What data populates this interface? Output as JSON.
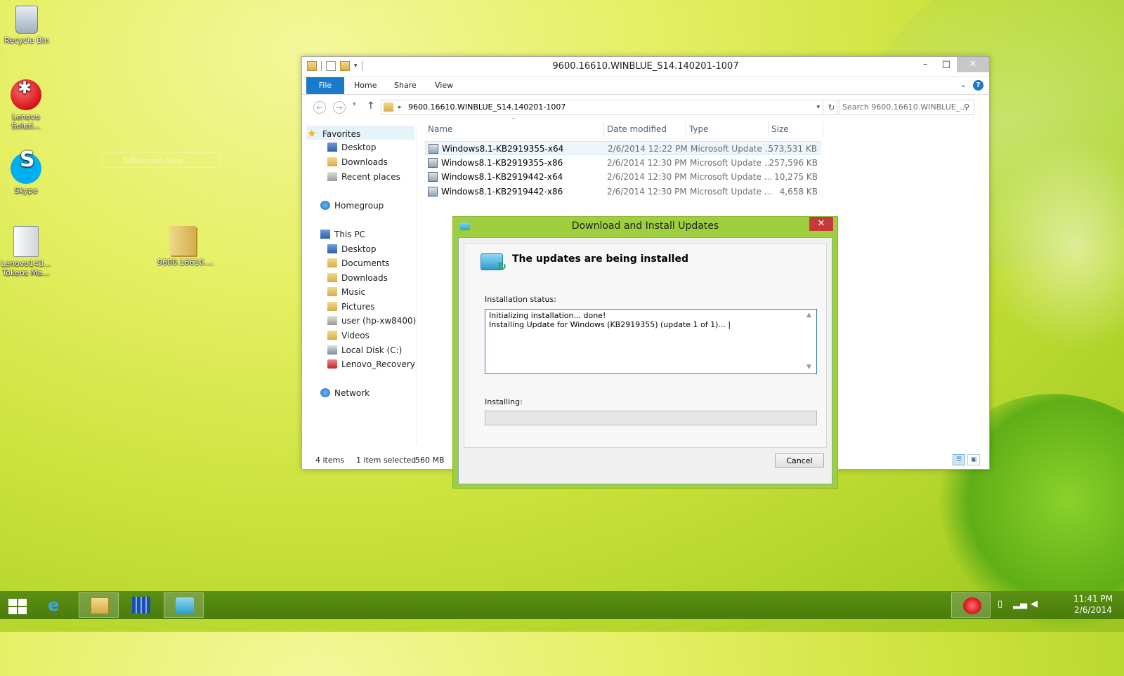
{
  "desktop": {
    "icons": [
      {
        "label": "Recycle Bin"
      },
      {
        "label": "Lenovo Soluti..."
      },
      {
        "label": "Skype"
      },
      {
        "label": "Lenovo143... Tokens Ma..."
      },
      {
        "label": "9600.16610...."
      }
    ],
    "snip_label": "Full-screen Snip"
  },
  "explorer": {
    "title": "9600.16610.WINBLUE_S14.140201-1007",
    "tabs": [
      "File",
      "Home",
      "Share",
      "View"
    ],
    "address": "9600.16610.WINBLUE_S14.140201-1007",
    "search_placeholder": "Search 9600.16610.WINBLUE_...",
    "nav": {
      "favorites": "Favorites",
      "fav_items": [
        "Desktop",
        "Downloads",
        "Recent places"
      ],
      "homegroup": "Homegroup",
      "thispc": "This PC",
      "pc_items": [
        "Desktop",
        "Documents",
        "Downloads",
        "Music",
        "Pictures",
        "user (hp-xw8400)",
        "Videos",
        "Local Disk (C:)",
        "Lenovo_Recovery (D"
      ],
      "network": "Network"
    },
    "columns": [
      "Name",
      "Date modified",
      "Type",
      "Size"
    ],
    "files": [
      {
        "name": "Windows8.1-KB2919355-x64",
        "date": "2/6/2014 12:22 PM",
        "type": "Microsoft Update ...",
        "size": "573,531 KB"
      },
      {
        "name": "Windows8.1-KB2919355-x86",
        "date": "2/6/2014 12:30 PM",
        "type": "Microsoft Update ...",
        "size": "257,596 KB"
      },
      {
        "name": "Windows8.1-KB2919442-x64",
        "date": "2/6/2014 12:30 PM",
        "type": "Microsoft Update ...",
        "size": "10,275 KB"
      },
      {
        "name": "Windows8.1-KB2919442-x86",
        "date": "2/6/2014 12:30 PM",
        "type": "Microsoft Update ...",
        "size": "4,658 KB"
      }
    ],
    "status": {
      "items": "4 items",
      "selected": "1 item selected",
      "size": "560 MB"
    }
  },
  "dialog": {
    "title": "Download and Install Updates",
    "heading": "The updates are being installed",
    "status_label": "Installation status:",
    "log_line1": "Initializing installation... done!",
    "log_line2": "Installing Update for Windows (KB2919355) (update 1 of 1)...",
    "installing_label": "Installing:",
    "progress": 0,
    "cancel_label": "Cancel"
  },
  "taskbar": {
    "time": "11:41 PM",
    "date": "2/6/2014"
  },
  "colors": {
    "accent": "#1979ca",
    "taskbar": "#4a7d0a",
    "dialog_frame": "#9fcf3f",
    "close_red": "#c7393a"
  }
}
